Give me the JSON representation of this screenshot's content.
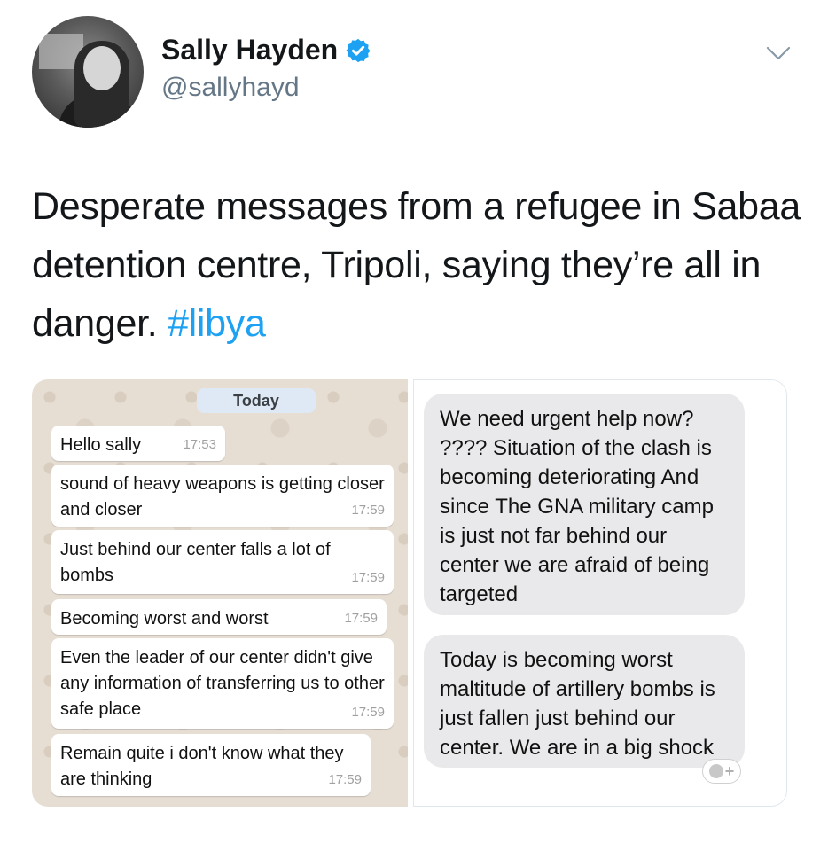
{
  "tweet": {
    "author": {
      "display_name": "Sally Hayden",
      "handle": "@sallyhayd",
      "verified": true
    },
    "text": "Desperate messages from a refugee in Sabaa detention centre, Tripoli, saying they’re all in danger. ",
    "hashtag": "#libya"
  },
  "whatsapp": {
    "date_label": "Today",
    "messages": [
      {
        "text": "Hello sally",
        "time": "17:53"
      },
      {
        "text": "sound of heavy weapons is getting closer and closer",
        "time": "17:59"
      },
      {
        "text": "Just behind our center falls a lot of bombs",
        "time": "17:59"
      },
      {
        "text": "Becoming worst and worst",
        "time": "17:59"
      },
      {
        "text": "Even the leader of our center didn't give any information of transferring us to other safe place",
        "time": "17:59"
      },
      {
        "text": "Remain quite i don't know what they are thinking",
        "time": "17:59"
      }
    ]
  },
  "imessage": {
    "messages": [
      {
        "text": "We need urgent help now? ???? Situation of the clash is becoming deteriorating And since The GNA military camp is just not far behind our center we are afraid of being targeted"
      },
      {
        "text": "Today is becoming worst maltitude of artillery bombs is just fallen just behind our center. We are in a big shock"
      }
    ],
    "reaction_button_label": "+"
  },
  "colors": {
    "hashtag": "#1da1f2",
    "verified_badge": "#1da1f2",
    "handle": "#657786",
    "whatsapp_background": "#e6ddd3",
    "imessage_bubble": "#e9e9eb"
  },
  "icons": [
    "avatar",
    "verified-badge-icon",
    "chevron-down-icon",
    "add-reaction-icon"
  ]
}
